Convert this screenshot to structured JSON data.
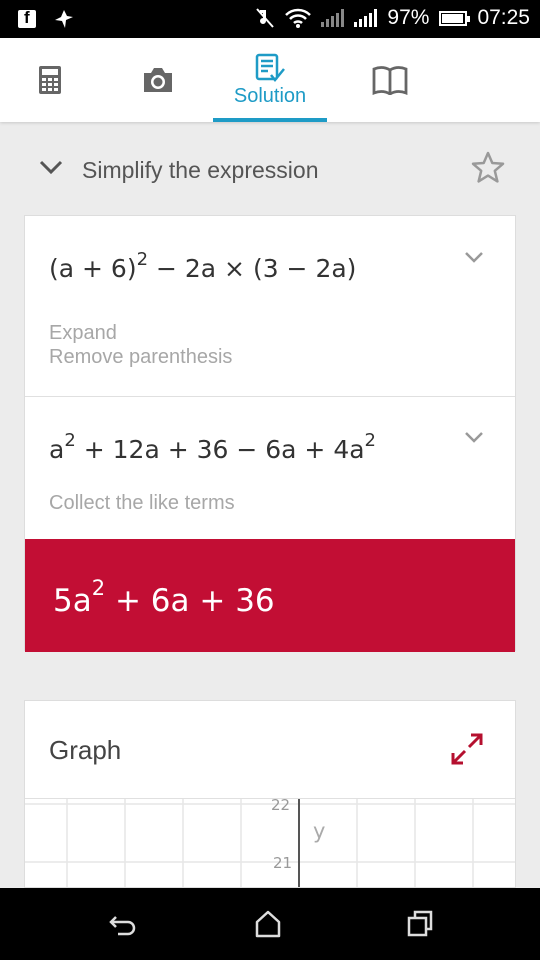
{
  "status_bar": {
    "battery": "97%",
    "time": "07:25",
    "icons": [
      "facebook-icon",
      "pin-icon",
      "mute-icon",
      "wifi-icon",
      "signal-icon",
      "signal-icon",
      "battery-icon"
    ]
  },
  "tabs": [
    {
      "icon": "calculator-icon",
      "label": ""
    },
    {
      "icon": "camera-icon",
      "label": ""
    },
    {
      "icon": "solution-icon",
      "label": "Solution",
      "active": true
    },
    {
      "icon": "book-icon",
      "label": ""
    }
  ],
  "header": {
    "title": "Simplify the expression"
  },
  "steps": [
    {
      "expression": [
        "(a + 6)",
        "2",
        "− 2a × (3 − 2a)"
      ],
      "hints": [
        "Expand",
        "Remove parenthesis"
      ]
    },
    {
      "expression": [
        "a",
        "2",
        "+ 12a + 36 − 6a + 4a",
        "2"
      ],
      "hints": [
        "Collect the like terms"
      ]
    }
  ],
  "result": {
    "base": "5a",
    "exp": "2",
    "rest": "+ 6a + 36"
  },
  "graph": {
    "title": "Graph",
    "y_ticks": [
      "22",
      "21"
    ],
    "y_label": "y"
  },
  "colors": {
    "accent": "#1e9bc6",
    "result_bg": "#c20e34",
    "expand_icon": "#b5102f"
  }
}
